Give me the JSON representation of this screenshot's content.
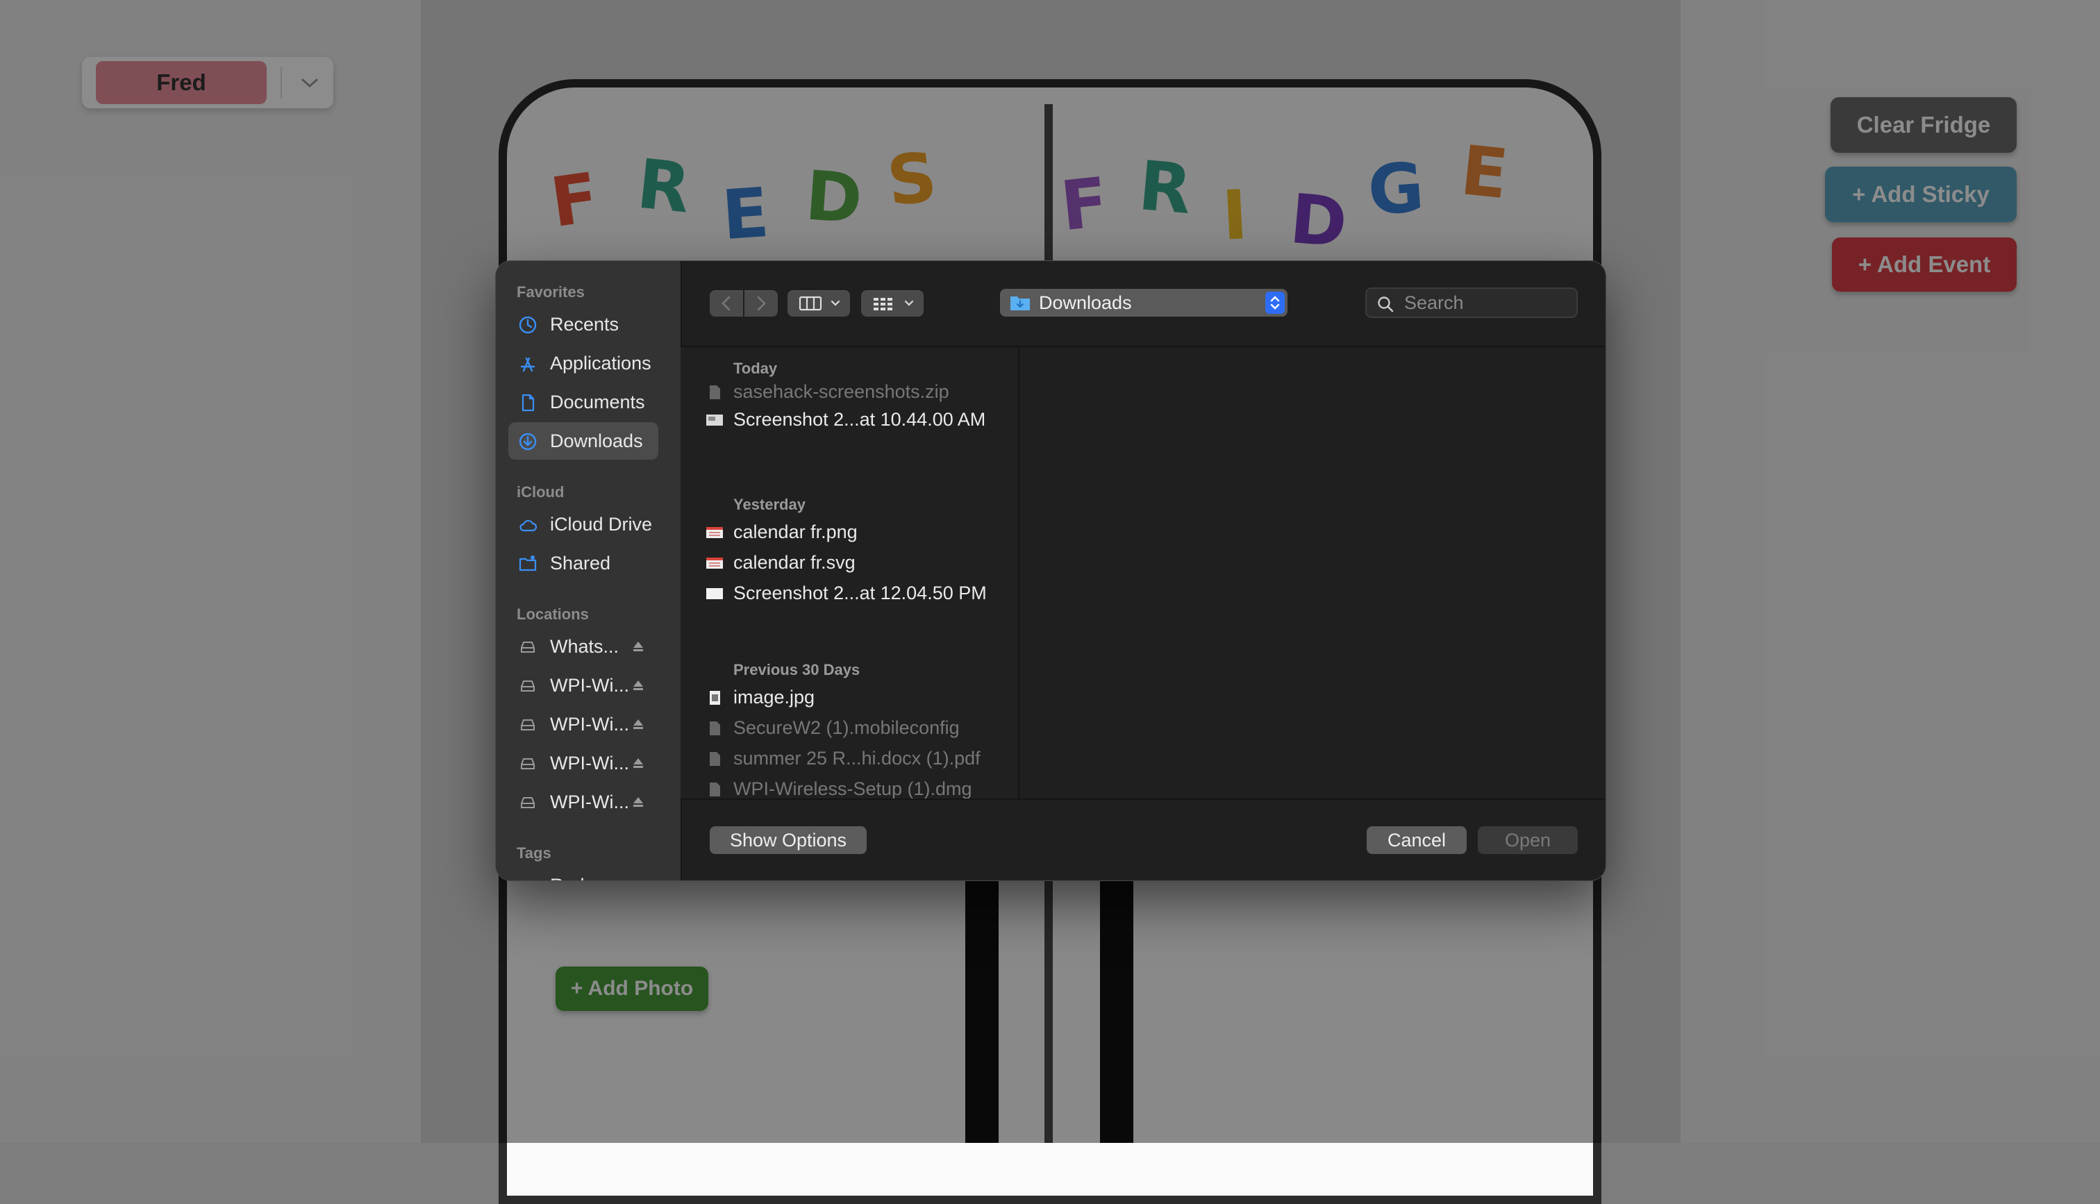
{
  "app": {
    "user_name": "Fred",
    "fridge_title_left": [
      "F",
      "R",
      "E",
      "D",
      "S"
    ],
    "fridge_title_right": [
      "F",
      "R",
      "I",
      "D",
      "G",
      "E"
    ],
    "buttons": {
      "clear_fridge": "Clear Fridge",
      "add_sticky": "+ Add Sticky",
      "add_event": "+ Add Event",
      "add_photo": "+ Add Photo"
    },
    "colors": {
      "user_pill": "#e9909b",
      "clear_fridge": "#6b6b6b",
      "add_sticky": "#5aa3bd",
      "add_event": "#d93e45",
      "add_photo": "#4a9a3a"
    }
  },
  "dialog": {
    "sidebar": {
      "favorites_header": "Favorites",
      "favorites": [
        {
          "label": "Recents",
          "icon": "clock-icon"
        },
        {
          "label": "Applications",
          "icon": "applications-icon"
        },
        {
          "label": "Documents",
          "icon": "document-icon"
        },
        {
          "label": "Downloads",
          "icon": "downloads-icon",
          "selected": true
        }
      ],
      "icloud_header": "iCloud",
      "icloud": [
        {
          "label": "iCloud Drive",
          "icon": "cloud-icon"
        },
        {
          "label": "Shared",
          "icon": "shared-folder-icon"
        }
      ],
      "locations_header": "Locations",
      "locations": [
        {
          "label": "Whats...",
          "icon": "drive-icon"
        },
        {
          "label": "WPI-Wi...",
          "icon": "drive-icon"
        },
        {
          "label": "WPI-Wi...",
          "icon": "drive-icon"
        },
        {
          "label": "WPI-Wi...",
          "icon": "drive-icon"
        },
        {
          "label": "WPI-Wi...",
          "icon": "drive-icon"
        }
      ],
      "tags_header": "Tags",
      "tags": [
        {
          "label": "Red",
          "color": "#ff453a"
        }
      ]
    },
    "toolbar": {
      "location": "Downloads",
      "search_placeholder": "Search"
    },
    "groups": [
      {
        "header": "Today",
        "files": [
          {
            "name": "sasehack-screenshots.zip",
            "enabled": false
          },
          {
            "name": "Screenshot 2...at 10.44.00 AM",
            "enabled": true
          }
        ]
      },
      {
        "header": "Yesterday",
        "files": [
          {
            "name": "calendar fr.png",
            "enabled": true
          },
          {
            "name": "calendar fr.svg",
            "enabled": true
          },
          {
            "name": "Screenshot 2...at 12.04.50 PM",
            "enabled": true
          }
        ]
      },
      {
        "header": "Previous 30 Days",
        "files": [
          {
            "name": "image.jpg",
            "enabled": true
          },
          {
            "name": "SecureW2 (1).mobileconfig",
            "enabled": false
          },
          {
            "name": "summer 25 R...hi.docx (1).pdf",
            "enabled": false
          },
          {
            "name": "WPI-Wireless-Setup (1).dmg",
            "enabled": false
          }
        ]
      }
    ],
    "buttons": {
      "show_options": "Show Options",
      "cancel": "Cancel",
      "open": "Open"
    }
  }
}
